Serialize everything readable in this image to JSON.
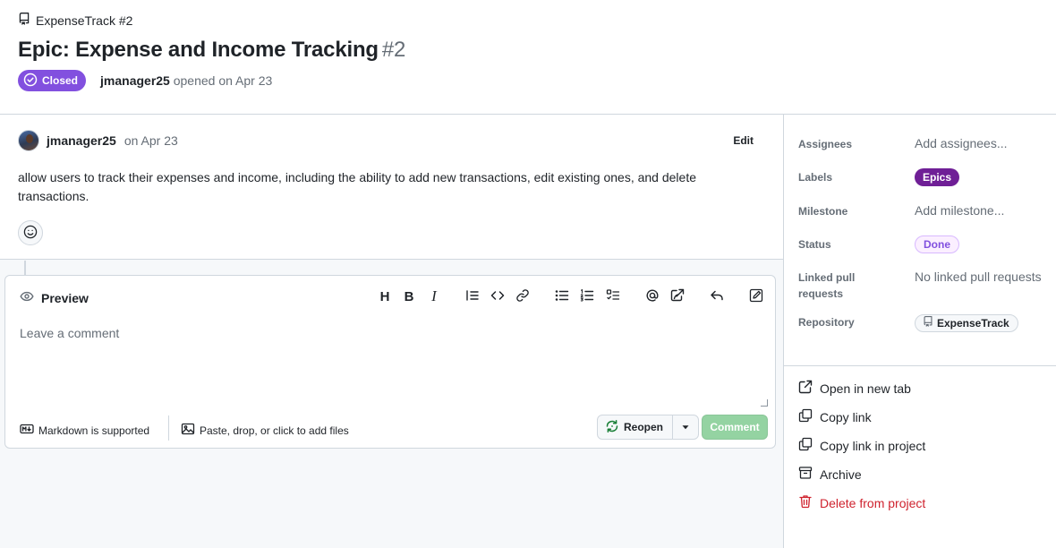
{
  "header": {
    "repo_crumb": "ExpenseTrack #2",
    "title": "Epic: Expense and Income Tracking",
    "number": "#2",
    "state": "Closed",
    "opener_user": "jmanager25",
    "opener_text": "opened on Apr 23"
  },
  "issue": {
    "author": "jmanager25",
    "date": "on Apr 23",
    "edit_label": "Edit",
    "body": "allow users to track their expenses and income, including the ability to add new transactions, edit existing ones, and delete transactions."
  },
  "composer": {
    "tab_label": "Preview",
    "toolbar": {
      "heading": "H",
      "bold": "B",
      "italic": "I"
    },
    "placeholder": "Leave a comment",
    "markdown_note": "Markdown is supported",
    "files_note": "Paste, drop, or click to add files",
    "reopen_label": "Reopen",
    "comment_label": "Comment"
  },
  "sidebar": {
    "assignees_label": "Assignees",
    "assignees_value": "Add assignees...",
    "labels_label": "Labels",
    "labels_value": "Epics",
    "milestone_label": "Milestone",
    "milestone_value": "Add milestone...",
    "status_label": "Status",
    "status_value": "Done",
    "linked_label": "Linked pull requests",
    "linked_value": "No linked pull requests",
    "repository_label": "Repository",
    "repository_value": "ExpenseTrack",
    "actions": {
      "open_new_tab": "Open in new tab",
      "copy_link": "Copy link",
      "copy_link_project": "Copy link in project",
      "archive": "Archive",
      "delete": "Delete from project"
    }
  },
  "colors": {
    "closed_badge": "#8250df",
    "epics_label": "#6f1f96",
    "done_text": "#8250df",
    "comment_button": "#94d3a2",
    "danger": "#cf222e"
  }
}
